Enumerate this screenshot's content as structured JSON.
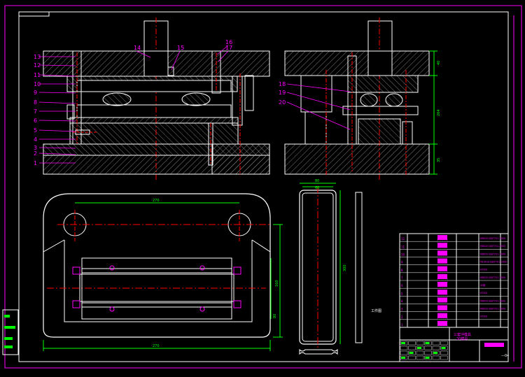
{
  "drawing": {
    "colors": {
      "background": "#000000",
      "outline": "#ffffff",
      "frame": "#ff00ff",
      "leader": "#ff00ff",
      "centerline": "#ff0000",
      "dimension": "#00ff00",
      "hatch": "#c0c0c0",
      "label": "#ff00ff",
      "title_fill": "#ff00ff"
    },
    "part_numbers_left": [
      "13",
      "12",
      "11",
      "10",
      "9",
      "8",
      "7",
      "6",
      "5",
      "4",
      "3",
      "2",
      "1"
    ],
    "part_numbers_top": [
      "14",
      "15",
      "16",
      "17"
    ],
    "part_numbers_right": [
      "18",
      "19",
      "20"
    ],
    "dims": {
      "side_height_total": "204",
      "side_top_thick": "40",
      "side_bottom_thick": "35",
      "plan_width": "270",
      "plan_hole_span": "270",
      "plan_height": "160",
      "plan_inner": "80",
      "strip_width_a": "80",
      "strip_width_b": "60",
      "strip_length": "300"
    },
    "side_note": "工件图",
    "title_block": {
      "title": "三套冲模具",
      "subtitle": "20模具",
      "sheet_no": "—04"
    },
    "bom_rows": [
      "M6X20 GB/T70.1-2000",
      "M8X20 GB/T70.1-2000",
      "M8X20 GB/T70.1-2000",
      "M10X16 GB/T70.1-2000",
      "HT200",
      "M8X20 GB/T70.1-2000",
      "45钢",
      "HT200",
      "M6X20 GB/T70.1-2000",
      "M6X20 GB/T70.1-2000",
      "HT200"
    ]
  }
}
